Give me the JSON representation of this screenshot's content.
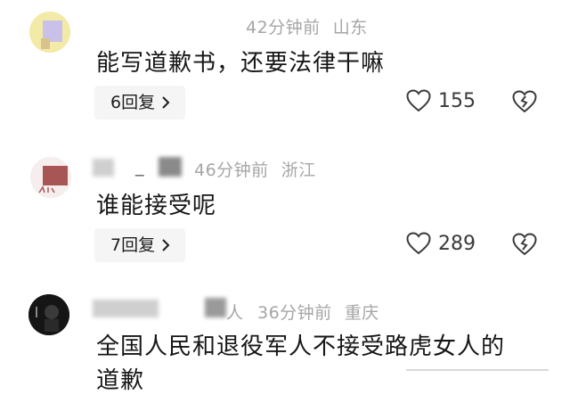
{
  "comments": [
    {
      "time": "42分钟前",
      "location": "山东",
      "text": "能写道歉书，还要法律干嘛",
      "replies_label": "6回复",
      "likes": "155"
    },
    {
      "username_visible": "_",
      "time": "46分钟前",
      "location": "浙江",
      "text": "谁能接受呢",
      "replies_label": "7回复",
      "likes": "289"
    },
    {
      "username_visible": "人",
      "time": "36分钟前",
      "location": "重庆",
      "text": "全国人民和退役军人不接受路虎女人的",
      "text_cont": "道歉"
    }
  ],
  "icons": {
    "like": "heart-outline-icon",
    "dislike": "broken-heart-icon",
    "chevron": "chevron-right-icon"
  }
}
